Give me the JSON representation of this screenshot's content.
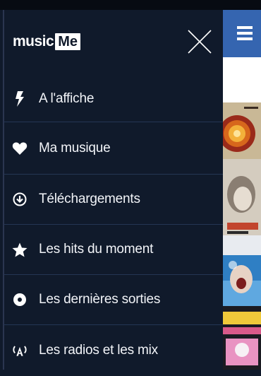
{
  "app": {
    "logo_text_music": "music",
    "logo_text_me": "Me"
  },
  "menu": {
    "items": [
      {
        "label": "A l'affiche",
        "icon": "lightning-bolt-icon"
      },
      {
        "label": "Ma musique",
        "icon": "heart-icon"
      },
      {
        "label": "Téléchargements",
        "icon": "download-circle-icon"
      },
      {
        "label": "Les hits du moment",
        "icon": "star-icon"
      },
      {
        "label": "Les dernières sorties",
        "icon": "disc-icon"
      },
      {
        "label": "Les radios et les mix",
        "icon": "radio-antenna-icon"
      }
    ]
  },
  "header": {
    "close_icon": "close-icon",
    "menu_icon": "hamburger-menu-icon"
  },
  "colors": {
    "drawer_bg": "#101a2b",
    "accent_blue": "#3565b0",
    "divider": "#243654",
    "text": "#f2f4f8"
  }
}
